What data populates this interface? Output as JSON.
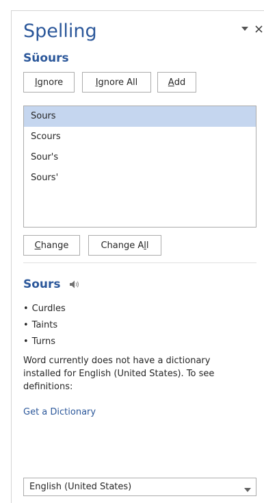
{
  "pane": {
    "title": "Spelling",
    "misspelled_word": "Süours"
  },
  "actions": {
    "ignore": {
      "pre": "",
      "key": "I",
      "post": "gnore"
    },
    "ignore_all": {
      "pre": "",
      "key": "I",
      "post": "gnore All"
    },
    "add": {
      "pre": "",
      "key": "A",
      "post": "dd"
    }
  },
  "suggestions": [
    "Sours",
    "Scours",
    "Sour's",
    "Sours'"
  ],
  "selected_suggestion_index": 0,
  "change_actions": {
    "change": {
      "pre": "",
      "key": "C",
      "post": "hange"
    },
    "change_all": {
      "pre": "Change A",
      "key": "l",
      "post": "l"
    }
  },
  "definition": {
    "word": "Sours",
    "synonyms": [
      "Curdles",
      "Taints",
      "Turns"
    ],
    "notice": "Word currently does not have a dictionary installed for English (United States). To see definitions:",
    "link": "Get a Dictionary"
  },
  "language": {
    "selected": "English (United States)"
  },
  "icons": {
    "pane_options": "dropdown-arrow-icon",
    "close": "close-icon",
    "pronounce": "speaker-icon",
    "language_dropdown": "chevron-down-icon"
  },
  "colors": {
    "accent": "#2b579a",
    "selection": "#c5d6ef",
    "border": "#ababab"
  }
}
